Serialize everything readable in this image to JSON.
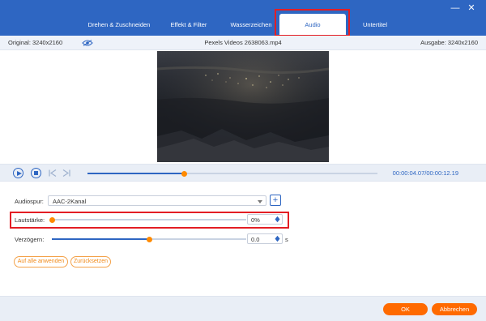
{
  "tabs": [
    {
      "label": "Drehen & Zuschneiden",
      "active": false
    },
    {
      "label": "Effekt & Filter",
      "active": false
    },
    {
      "label": "Wasserzeichen",
      "active": false
    },
    {
      "label": "Audio",
      "active": true
    },
    {
      "label": "Untertitel",
      "active": false
    }
  ],
  "window_controls": {
    "minimize": "—",
    "close": "✕"
  },
  "info": {
    "original": "Original: 3240x2160",
    "filename": "Pexels Videos 2638063.mp4",
    "output": "Ausgabe: 3240x2160"
  },
  "playback": {
    "current_time": "00:00:04.07",
    "separator": "/",
    "total_time": "00:00:12.19",
    "progress_fraction": 0.335
  },
  "audio": {
    "track_label": "Audiospur:",
    "track_value": "AAC-2Kanal",
    "add_symbol": "+",
    "volume_label": "Lautstärke:",
    "volume_value": "0%",
    "volume_fraction": 0.0,
    "delay_label": "Verzögern:",
    "delay_value": "0.0",
    "delay_fraction": 0.5,
    "delay_unit": "s",
    "apply_all": "Auf alle anwenden",
    "reset": "Zurücksetzen"
  },
  "footer": {
    "ok": "OK",
    "cancel": "Abbrechen"
  },
  "colors": {
    "brand_blue": "#2e66c2",
    "accent_orange": "#ff6a00",
    "highlight_red": "#e31e24"
  }
}
